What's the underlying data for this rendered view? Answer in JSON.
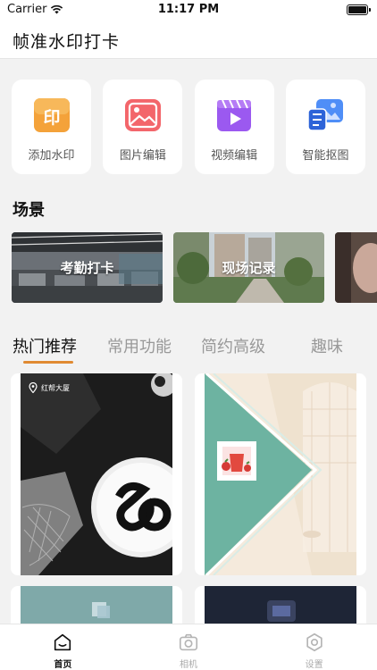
{
  "status_bar": {
    "carrier": "Carrier",
    "time": "11:17 PM"
  },
  "app": {
    "title": "帧准水印打卡"
  },
  "tools": [
    {
      "label": "添加水印",
      "icon": "watermark-icon"
    },
    {
      "label": "图片编辑",
      "icon": "image-edit-icon"
    },
    {
      "label": "视频编辑",
      "icon": "video-edit-icon"
    },
    {
      "label": "智能抠图",
      "icon": "cutout-icon"
    }
  ],
  "scenes_section": {
    "title": "场景"
  },
  "scenes": [
    {
      "label": "考勤打卡"
    },
    {
      "label": "现场记录"
    },
    {
      "label": ""
    }
  ],
  "tabs": [
    {
      "label": "热门推荐",
      "active": true
    },
    {
      "label": "常用功能",
      "active": false
    },
    {
      "label": "简约高级",
      "active": false
    },
    {
      "label": "趣味",
      "active": false
    }
  ],
  "cards": {
    "card1_location": "红帮大厦"
  },
  "tabbar": [
    {
      "label": "首页",
      "icon": "home-icon",
      "active": true
    },
    {
      "label": "相机",
      "icon": "camera-icon",
      "active": false
    },
    {
      "label": "设置",
      "icon": "settings-icon",
      "active": false
    }
  ],
  "colors": {
    "accent": "#e08a32"
  }
}
